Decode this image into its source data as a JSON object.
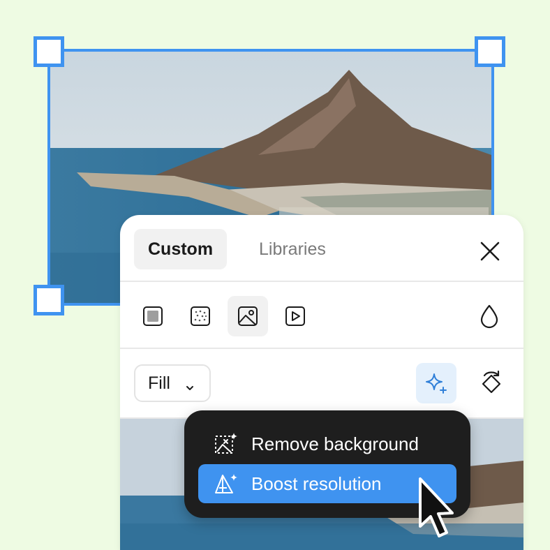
{
  "colors": {
    "canvas_background": "#eefbe3",
    "selection_accent": "#3f93f0",
    "menu_background": "#1e1e1e",
    "ai_button_background": "#e4f0fc"
  },
  "canvas": {
    "selected_image": {
      "subject": "pixelated photo of a coastal mountain and sea"
    }
  },
  "panel": {
    "tabs": [
      {
        "label": "Custom",
        "active": true
      },
      {
        "label": "Libraries",
        "active": false
      }
    ],
    "close_icon": "close-icon",
    "fill_types": [
      {
        "icon": "solid-fill-icon",
        "selected": false
      },
      {
        "icon": "noise-fill-icon",
        "selected": false
      },
      {
        "icon": "image-fill-icon",
        "selected": true
      },
      {
        "icon": "video-fill-icon",
        "selected": false
      }
    ],
    "opacity_icon": "droplet-icon",
    "fill_mode": {
      "value": "Fill"
    },
    "ai_tools_icon": "sparkle-icon",
    "swap_icon": "swap-icon"
  },
  "ai_menu": {
    "items": [
      {
        "label": "Remove background",
        "icon": "remove-background-icon",
        "highlighted": false
      },
      {
        "label": "Boost resolution",
        "icon": "boost-resolution-icon",
        "highlighted": true
      }
    ]
  }
}
